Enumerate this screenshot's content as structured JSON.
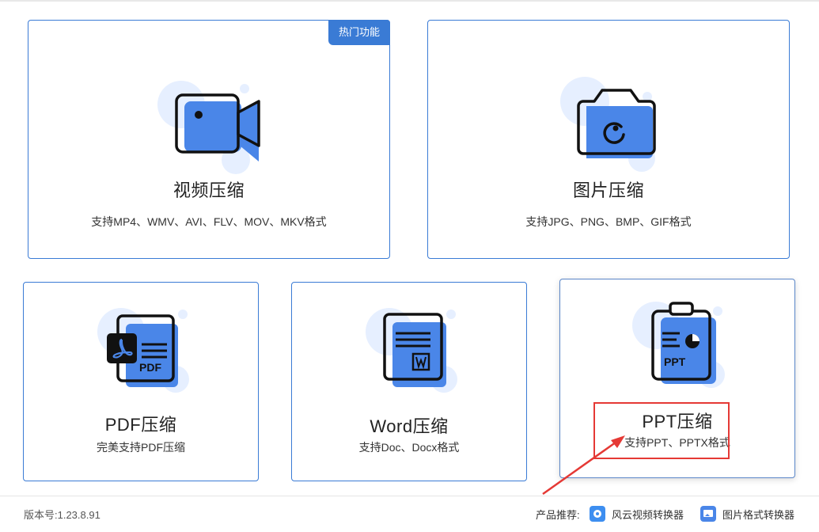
{
  "cards": [
    {
      "title": "视频压缩",
      "desc": "支持MP4、WMV、AVI、FLV、MOV、MKV格式",
      "icon": "video-camera-icon"
    },
    {
      "title": "图片压缩",
      "desc": "支持JPG、PNG、BMP、GIF格式",
      "icon": "camera-icon"
    },
    {
      "title": "PDF压缩",
      "desc": "完美支持PDF压缩",
      "icon": "pdf-document-icon",
      "icon_label": "PDF"
    },
    {
      "title": "Word压缩",
      "desc": "支持Doc、Docx格式",
      "icon": "word-document-icon"
    },
    {
      "title": "PPT压缩",
      "desc": "支持PPT、PPTX格式",
      "icon": "ppt-clipboard-icon",
      "icon_label": "PPT"
    }
  ],
  "hot_badge": "热门功能",
  "footer": {
    "version": "版本号:1.23.8.91",
    "recommend_label": "产品推荐:",
    "products": [
      {
        "label": "风云视频转换器",
        "icon": "video-converter-app-icon"
      },
      {
        "label": "图片格式转换器",
        "icon": "image-converter-app-icon"
      }
    ]
  },
  "colors": {
    "accent": "#3a7bd5",
    "icon_fill": "#4a86e8",
    "icon_bg_circle": "#e6efff",
    "annotation": "#e53935"
  }
}
